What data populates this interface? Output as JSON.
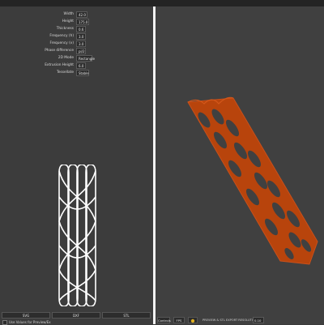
{
  "params": [
    {
      "label": "Width",
      "value": "42.0"
    },
    {
      "label": "Height",
      "value": "175.0"
    },
    {
      "label": "Thickness",
      "value": "0.6"
    },
    {
      "label": "Frequency (h)",
      "value": "3.0"
    },
    {
      "label": "Frequency (v)",
      "value": "3.0"
    },
    {
      "label": "Phase difference",
      "value": "pi/2"
    },
    {
      "label": "2D Mode",
      "value": "Rectangle"
    },
    {
      "label": "Extrusion Height",
      "value": "6.0"
    },
    {
      "label": "Tessellate",
      "value": "Stable"
    }
  ],
  "export_buttons": [
    "SVG",
    "DXF",
    "STL"
  ],
  "checkbox_label": "Use Values for Preview/Ex",
  "bottom_bar": {
    "controls_label": "Controls",
    "fps_label": "FPS",
    "resolution_label": "PREVIEW & STL EXPORT RESOLUTION",
    "resolution_value": "0.10"
  },
  "colors": {
    "mesh": "#b8440c",
    "mesh_edge": "#d4571a",
    "outline": "#ffffff",
    "sun": "#e0b020"
  }
}
